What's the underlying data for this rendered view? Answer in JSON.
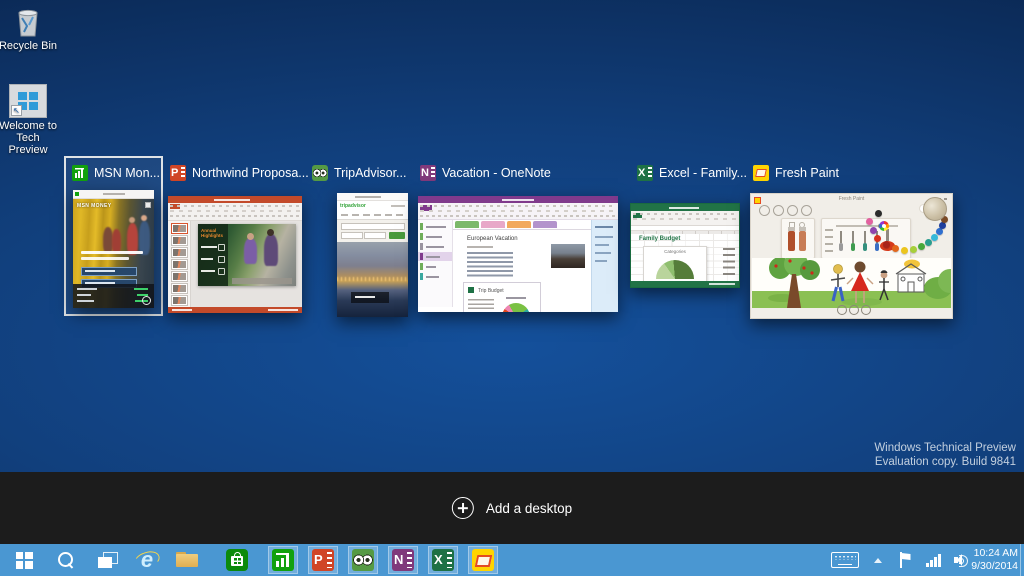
{
  "colors": {
    "taskbar_blue": "#4a97d2",
    "bottom_strip": "#1c1c1c",
    "wallpaper_center": "#14509b",
    "wallpaper_edge": "#071c3a",
    "selection_border": "#dfe3e6",
    "msn_green": "#12a10e",
    "powerpoint_orange": "#d04526",
    "tripadvisor_green": "#559a44",
    "onenote_purple": "#80397b",
    "excel_green": "#217346",
    "freshpaint_yellow": "#ffd400",
    "store_green": "#0c8a0c"
  },
  "desktop": {
    "icons": [
      {
        "label": "Recycle Bin"
      },
      {
        "label": "Welcome to Tech Preview"
      }
    ],
    "watermark": {
      "line1": "Windows Technical Preview",
      "line2": "Evaluation copy. Build 9841"
    }
  },
  "task_view": {
    "add_desktop_label": "Add a desktop",
    "windows": [
      {
        "title": "MSN Mon...",
        "thumb": {
          "brand": "MSN MONEY"
        }
      },
      {
        "title": "Northwind Proposa...",
        "thumb": {
          "headline": "Annual Highlights"
        }
      },
      {
        "title": "TripAdvisor...",
        "thumb": {
          "brand": "tripadvisor"
        }
      },
      {
        "title": "Vacation - OneNote",
        "thumb": {
          "page_title": "European Vacation",
          "embed_title": "Trip Budget"
        }
      },
      {
        "title": "Excel - Family...",
        "thumb": {
          "sheet_title": "Family Budget",
          "chart_title": "Categories"
        }
      },
      {
        "title": "Fresh Paint",
        "thumb": {
          "window_title": "Fresh Paint"
        }
      }
    ]
  },
  "icon_letters": {
    "powerpoint": "P",
    "onenote": "N",
    "excel": "X"
  },
  "taskbar": {
    "clock_time": "10:24 AM",
    "clock_date": "9/30/2014"
  }
}
